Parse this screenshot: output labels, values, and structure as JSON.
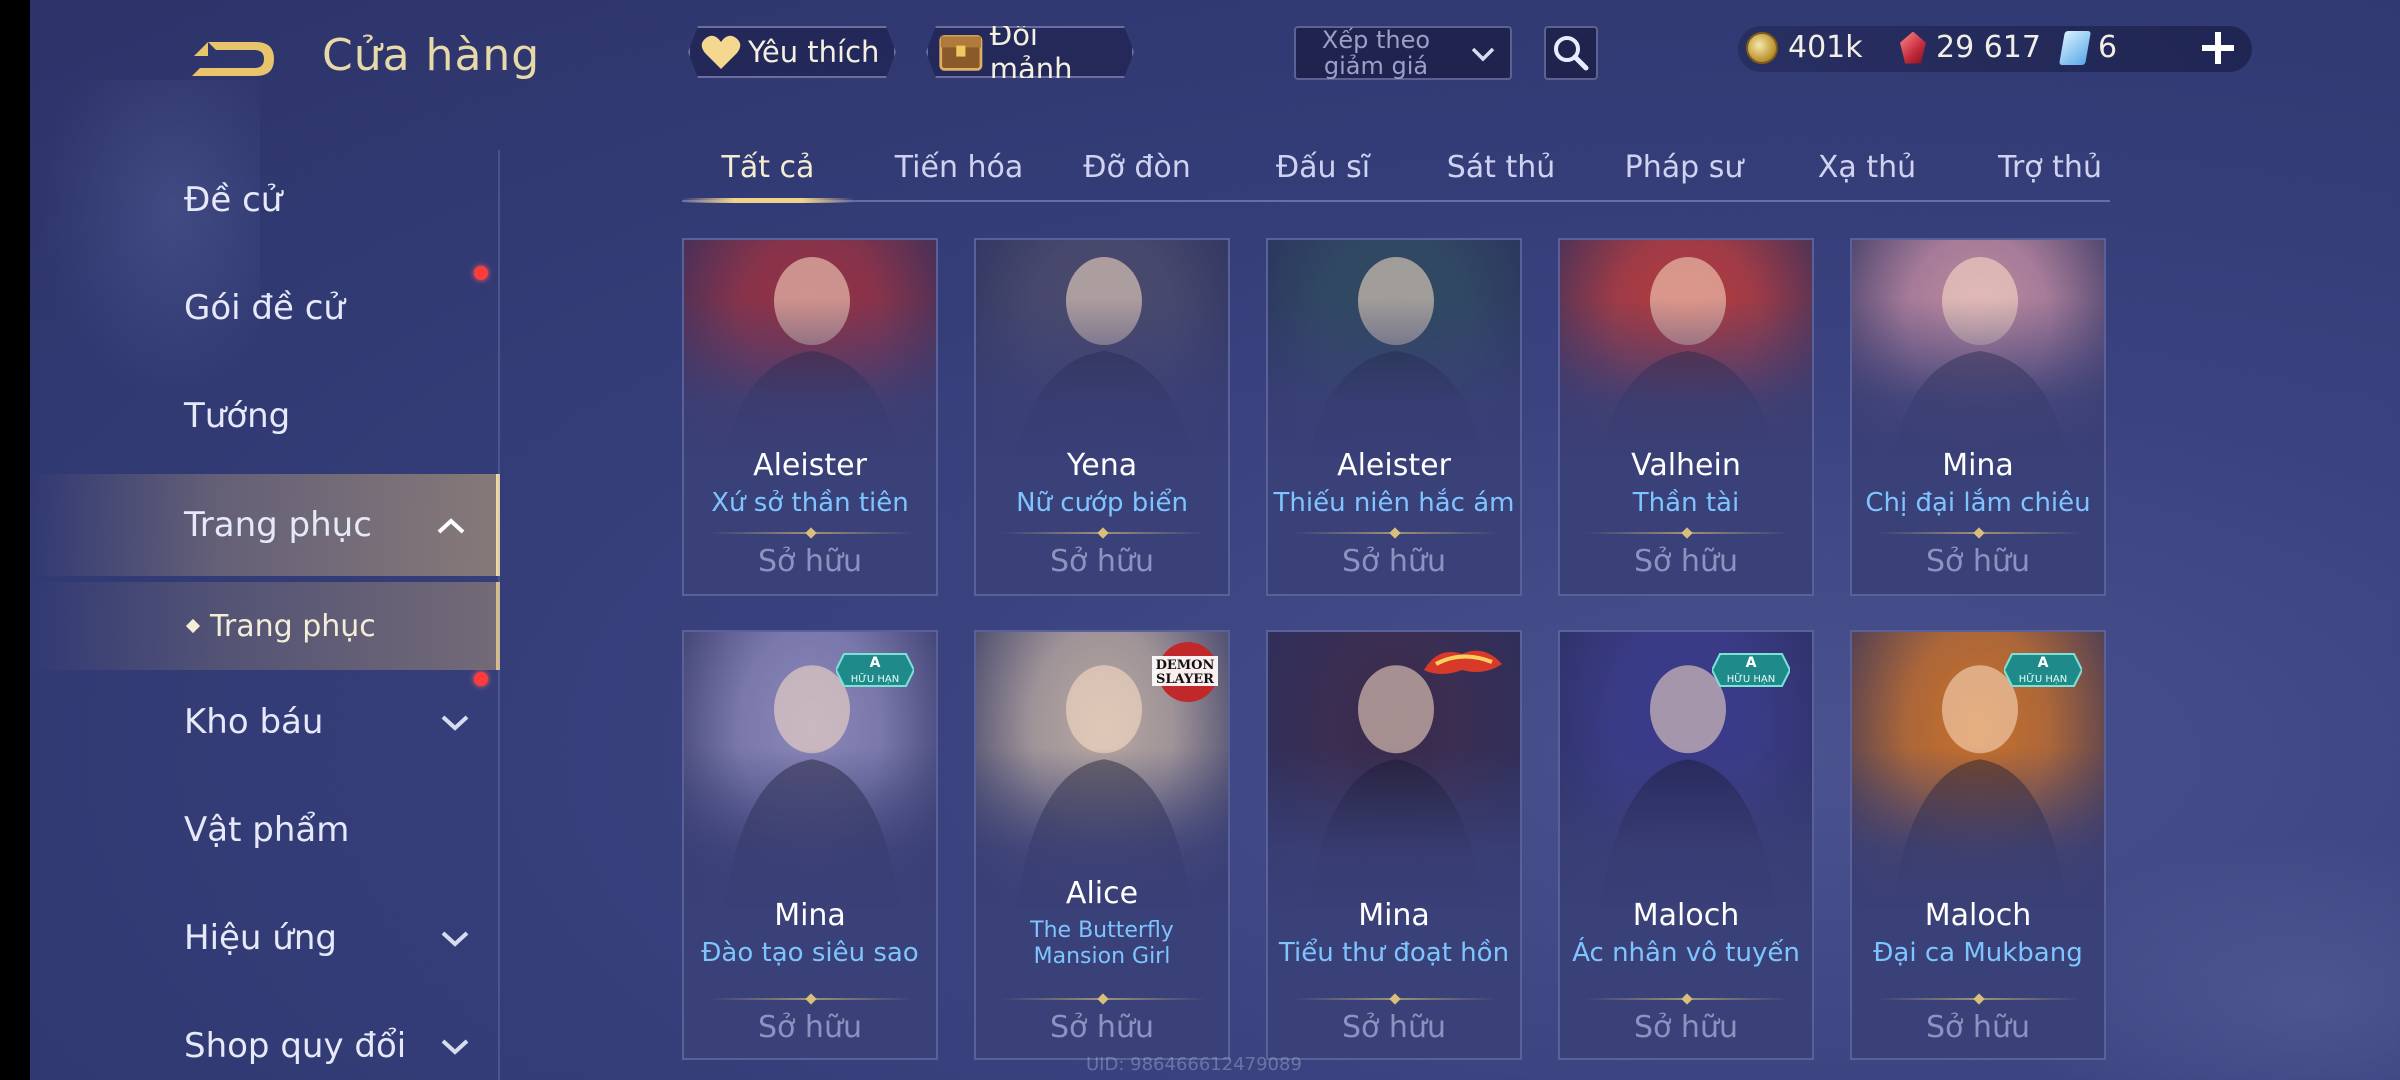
{
  "header": {
    "title": "Cửa hàng",
    "favorite_label": "Yêu thích",
    "fragment_label": "Đổi mảnh",
    "sort_label": "Xếp theo giảm giá"
  },
  "currency": {
    "gold": "401k",
    "ruby": "29 617",
    "cards": "6"
  },
  "sidebar": {
    "items": [
      {
        "label": "Đề cử"
      },
      {
        "label": "Gói đề cử"
      },
      {
        "label": "Tướng"
      },
      {
        "label": "Trang phục"
      },
      {
        "label": "Trang phục"
      },
      {
        "label": "Kho báu"
      },
      {
        "label": "Vật phẩm"
      },
      {
        "label": "Hiệu ứng"
      },
      {
        "label": "Shop quy đổi"
      }
    ]
  },
  "tabs": [
    {
      "label": "Tất cả",
      "active": true
    },
    {
      "label": "Tiến hóa"
    },
    {
      "label": "Đỡ đòn"
    },
    {
      "label": "Đấu sĩ"
    },
    {
      "label": "Sát thủ"
    },
    {
      "label": "Pháp sư"
    },
    {
      "label": "Xạ thủ"
    },
    {
      "label": "Trợ thủ"
    }
  ],
  "cards": [
    {
      "hero": "Aleister",
      "skin": "Xứ sở thần tiên",
      "status": "Sở hữu",
      "color": "#9a3040"
    },
    {
      "hero": "Yena",
      "skin": "Nữ cướp biển",
      "status": "Sở hữu",
      "color": "#4a4a6a"
    },
    {
      "hero": "Aleister",
      "skin": "Thiếu niên hắc ám",
      "status": "Sở hữu",
      "color": "#2e4a5e"
    },
    {
      "hero": "Valhein",
      "skin": "Thần tài",
      "status": "Sở hữu",
      "color": "#b83a3a"
    },
    {
      "hero": "Mina",
      "skin": "Chị đại lắm chiêu",
      "status": "Sở hữu",
      "color": "#c08aa0"
    },
    {
      "hero": "Mina",
      "skin": "Đào tạo siêu sao",
      "status": "Sở hữu",
      "color": "#8a86b8",
      "badge": "A",
      "badge_sub": "HỮU HẠN"
    },
    {
      "hero": "Alice",
      "skin": "The Butterfly Mansion Girl",
      "status": "Sở hữu",
      "color": "#b8a8a0",
      "logo": "DEMON SLAYER"
    },
    {
      "hero": "Mina",
      "skin": "Tiểu thư đoạt hồn",
      "status": "Sở hữu",
      "color": "#3a2a4a"
    },
    {
      "hero": "Maloch",
      "skin": "Ác nhân vô tuyến",
      "status": "Sở hữu",
      "color": "#3a3a8a",
      "badge": "A",
      "badge_sub": "HỮU HẠN"
    },
    {
      "hero": "Maloch",
      "skin": "Đại ca Mukbang",
      "status": "Sở hữu",
      "color": "#c8702a",
      "badge": "A",
      "badge_sub": "HỮU HẠN"
    }
  ],
  "footer": {
    "uid": "UID: 986466612479089"
  },
  "colors": {
    "accent_gold": "#f0d28c",
    "skin_blue": "#7ec4ff",
    "notify_red": "#ff3b3b"
  }
}
